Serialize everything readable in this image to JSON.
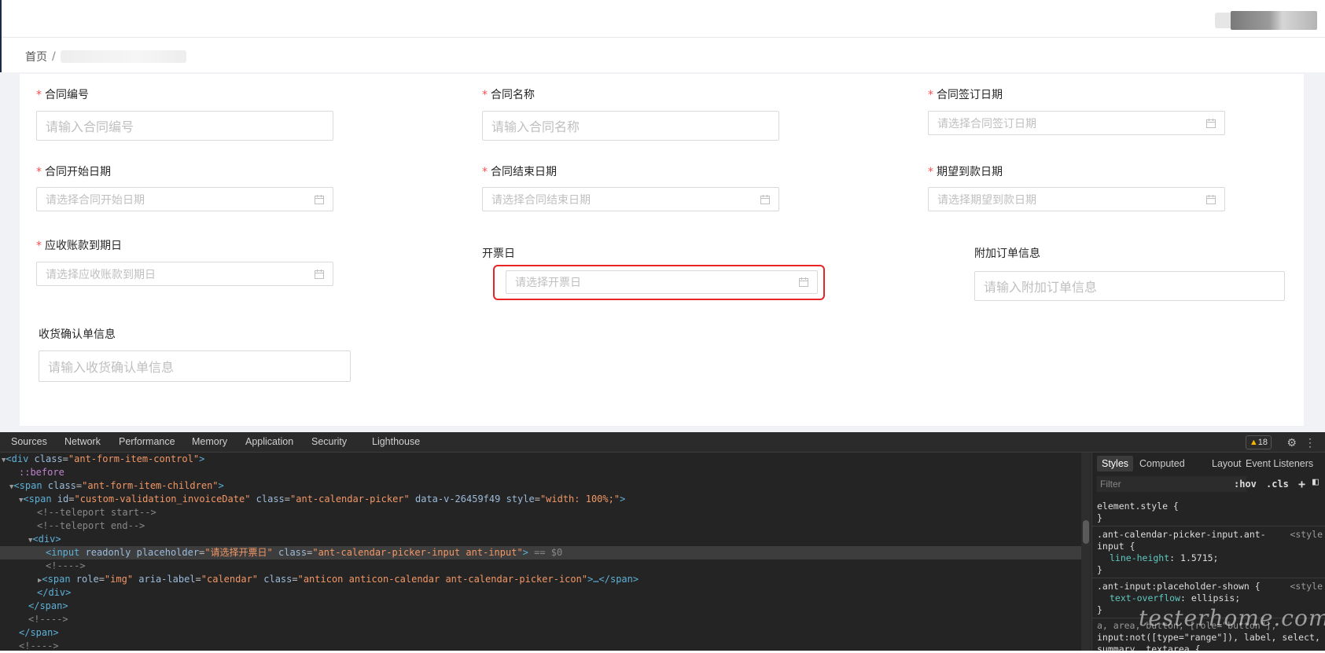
{
  "breadcrumb": {
    "home": "首页",
    "sep": "/"
  },
  "form": {
    "fields": [
      {
        "label": "合同编号",
        "required": true,
        "placeholder": "请输入合同编号",
        "type": "text"
      },
      {
        "label": "合同名称",
        "required": true,
        "placeholder": "请输入合同名称",
        "type": "text"
      },
      {
        "label": "合同签订日期",
        "required": true,
        "placeholder": "请选择合同签订日期",
        "type": "date"
      },
      {
        "label": "合同开始日期",
        "required": true,
        "placeholder": "请选择合同开始日期",
        "type": "date"
      },
      {
        "label": "合同结束日期",
        "required": true,
        "placeholder": "请选择合同结束日期",
        "type": "date"
      },
      {
        "label": "期望到款日期",
        "required": true,
        "placeholder": "请选择期望到款日期",
        "type": "date"
      },
      {
        "label": "应收账款到期日",
        "required": true,
        "placeholder": "请选择应收账款到期日",
        "type": "date"
      },
      {
        "label": "开票日",
        "required": false,
        "placeholder": "请选择开票日",
        "type": "date"
      },
      {
        "label": "附加订单信息",
        "required": false,
        "placeholder": "请输入附加订单信息",
        "type": "text"
      },
      {
        "label": "收货确认单信息",
        "required": false,
        "placeholder": "请输入收货确认单信息",
        "type": "text"
      }
    ],
    "required_mark": "*"
  },
  "devtools": {
    "tabs": [
      "Sources",
      "Network",
      "Performance",
      "Memory",
      "Application",
      "Security",
      "Lighthouse"
    ],
    "warnings": "18",
    "warn_icon": "▲",
    "elements": {
      "l1_tag_open": "<div ",
      "l1_attr": "class",
      "l1_val": "\"ant-form-item-control\"",
      "l1_close": ">",
      "l2": "::before",
      "l3_tag_open": "<span ",
      "l3_attr": "class",
      "l3_val": "\"ant-form-item-children\"",
      "l3_close": ">",
      "l4_tag_open": "<span ",
      "l4_a1": "id",
      "l4_v1": "\"custom-validation_invoiceDate\"",
      "l4_a2": " class",
      "l4_v2": "\"ant-calendar-picker\"",
      "l4_a3": " data-v-26459f49",
      "l4_a4": " style",
      "l4_v4": "\"width: 100%;\"",
      "l4_close": ">",
      "l5": "<!--teleport start-->",
      "l6": "<!--teleport end-->",
      "l7": "<div>",
      "l8_tag_open": "<input ",
      "l8_a1": "readonly",
      "l8_a2": " placeholder",
      "l8_v2": "\"请选择开票日\"",
      "l8_a3": " class",
      "l8_v3": "\"ant-calendar-picker-input ant-input\"",
      "l8_close": ">",
      "l8_eq": " == $0",
      "l9": "<!---->",
      "l10_tag_open": "<span ",
      "l10_a1": "role",
      "l10_v1": "\"img\"",
      "l10_a2": " aria-label",
      "l10_v2": "\"calendar\"",
      "l10_a3": " class",
      "l10_v3": "\"anticon anticon-calendar ant-calendar-picker-icon\"",
      "l10_close": ">…</span>",
      "l11": "</div>",
      "l12": "</span>",
      "l13": "<!---->",
      "l14": "</span>",
      "l15": "<!---->"
    },
    "styles": {
      "tabs": [
        "Styles",
        "Computed",
        "Layout",
        "Event Listeners"
      ],
      "filter_placeholder": "Filter",
      "hov": ":hov",
      "cls": ".cls",
      "plus": "+",
      "r1_sel": "element.style {",
      "r1_end": "}",
      "r2_sel": ".ant-calendar-picker-input.ant-",
      "r2_sel2": "input {",
      "r2_src": "<style",
      "r2_prop": "line-height",
      "r2_val": ": 1.5715;",
      "r2_end": "}",
      "r3_sel": ".ant-input:placeholder-shown {",
      "r3_src": "<style",
      "r3_prop": "text-overflow",
      "r3_val": ": ellipsis;",
      "r3_end": "}",
      "r4_a": "a, area, button, [role=\"button\"],",
      "r4_b": "input:not([type=\"range\"]), label, select,",
      "r4_c": "summary, textarea {"
    }
  },
  "watermark": "testerhome.com"
}
